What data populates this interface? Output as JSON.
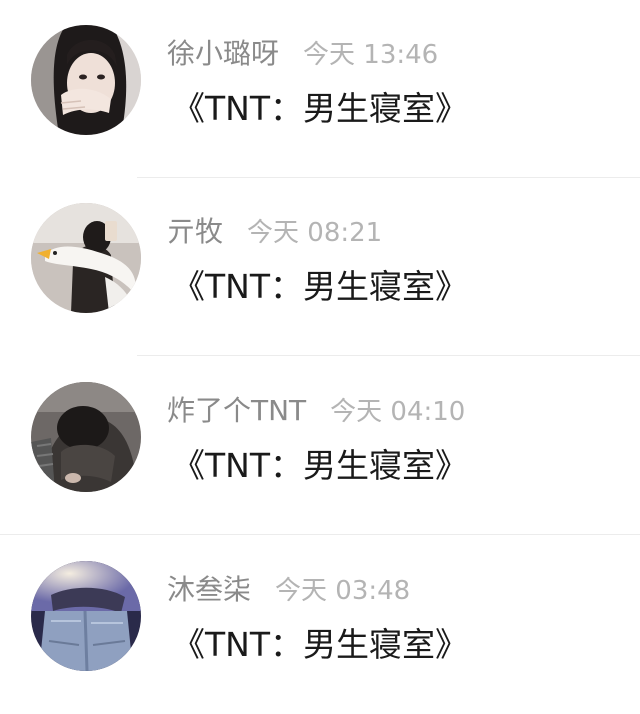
{
  "messages": [
    {
      "username": "徐小璐呀",
      "time": "今天 13:46",
      "text": "《TNT：男生寝室》",
      "avatar": "avatar-hand-over-face"
    },
    {
      "username": "亓牧",
      "time": "今天 08:21",
      "text": "《TNT：男生寝室》",
      "avatar": "avatar-goose-plush"
    },
    {
      "username": "炸了个TNT",
      "time": "今天 04:10",
      "text": "《TNT：男生寝室》",
      "avatar": "avatar-hooded-figure"
    },
    {
      "username": "沐叁柒",
      "time": "今天 03:48",
      "text": "《TNT：男生寝室》",
      "avatar": "avatar-light-jeans"
    }
  ]
}
